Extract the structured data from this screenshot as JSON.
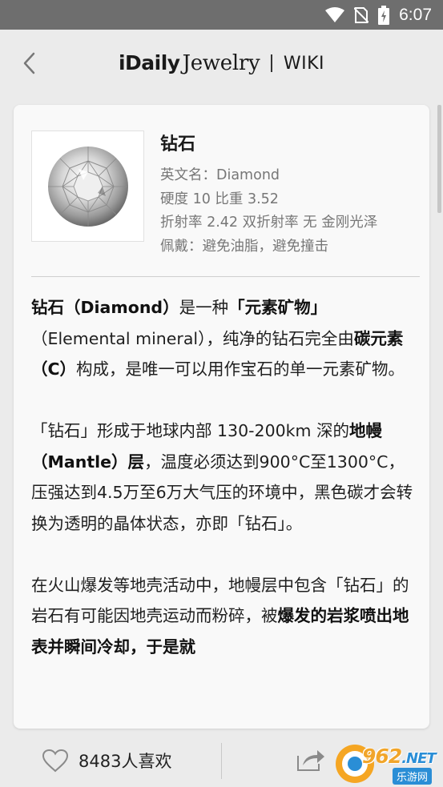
{
  "status_bar": {
    "time": "6:07"
  },
  "header": {
    "brand_idaily": "iDaily",
    "brand_jewelry": "Jewelry",
    "section": "WIKI"
  },
  "gem": {
    "name": "钻石",
    "english_name": "英文名：Diamond",
    "hardness_gravity": "硬度 10   比重 3.52",
    "optics": "折射率 2.42   双折射率 无 金刚光泽",
    "wearing": "佩戴：避免油脂，避免撞击"
  },
  "article": {
    "p1": {
      "a": "钻石（Diamond）",
      "b": "是一种",
      "c": "「元素矿物」",
      "d": "（Elemental mineral），纯净的钻石完全由",
      "e": "碳元素（C）",
      "f": "构成，是唯一可以用作宝石的单一元素矿物。"
    },
    "p2": {
      "a": "「钻石」形成于地球内部 130-200km 深的",
      "b": "地幔（Mantle）层",
      "c": "，温度必须达到900°C至1300°C，压强达到4.5万至6万大气压的环境中，黑色碳才会转换为透明的晶体状态，亦即「钻石」。"
    },
    "p3": {
      "a": "在火山爆发等地壳活动中，地幔层中包含「钻石」的岩石有可能因地壳运动而粉碎，被",
      "b": "爆发的岩浆喷出地表并瞬间冷却，于是就"
    }
  },
  "footer": {
    "like_count": "8483",
    "like_suffix": "人喜欢"
  },
  "watermark": {
    "main": "962",
    "net": ".NET",
    "sub": "乐游网"
  },
  "icons": {
    "back": "chevron-left-icon",
    "like": "heart-outline-icon",
    "share": "share-icon",
    "wifi": "wifi-icon",
    "no_sim": "no-sim-icon",
    "battery": "battery-charging-icon"
  },
  "colors": {
    "status_bar": "#6e6e6e",
    "background": "#ebebeb",
    "card": "#f9f9f9",
    "secondary_text": "#777777"
  }
}
